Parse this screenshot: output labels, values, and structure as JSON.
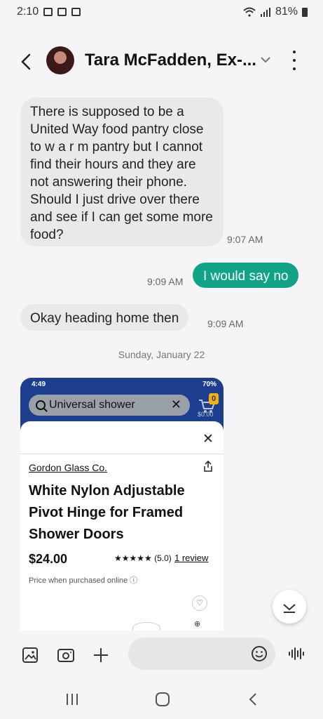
{
  "status_bar": {
    "time": "2:10",
    "battery": "81%"
  },
  "header": {
    "contact_name": "Tara McFadden, Ex-..."
  },
  "messages": [
    {
      "direction": "incoming",
      "text": "There is supposed to be a United Way food pantry close to w a r m pantry but I cannot find their hours and they are not answering their phone. Should I just drive over there and see if I can get some more food?",
      "time": "9:07 AM"
    },
    {
      "direction": "outgoing",
      "text": "I would say no",
      "time": "9:09 AM"
    },
    {
      "direction": "incoming",
      "text": "Okay heading home then",
      "time": "9:09 AM"
    }
  ],
  "date_separator": "Sunday, January 22",
  "shared_screenshot": {
    "status_time": "4:49",
    "status_battery": "70%",
    "search_text": "Universal shower",
    "cart_count": "0",
    "cart_total": "$0.00",
    "seller": "Gordon Glass Co.",
    "product_title": "White Nylon Adjustable Pivot Hinge for Framed Shower Doors",
    "price": "$24.00",
    "rating": "★★★★★ (5.0)",
    "reviews": "1 review",
    "note": "Price when purchased online ⓘ"
  },
  "colors": {
    "outgoing_bubble": "#10a386",
    "incoming_bubble": "#e9e9ec",
    "walmart_blue": "#1d3d8f"
  },
  "icons": [
    "back-arrow-icon",
    "chevron-down-icon",
    "more-vert-icon",
    "gallery-icon",
    "camera-icon",
    "plus-icon",
    "emoji-icon",
    "voice-icon",
    "recent-apps-icon",
    "home-icon",
    "back-nav-icon"
  ]
}
